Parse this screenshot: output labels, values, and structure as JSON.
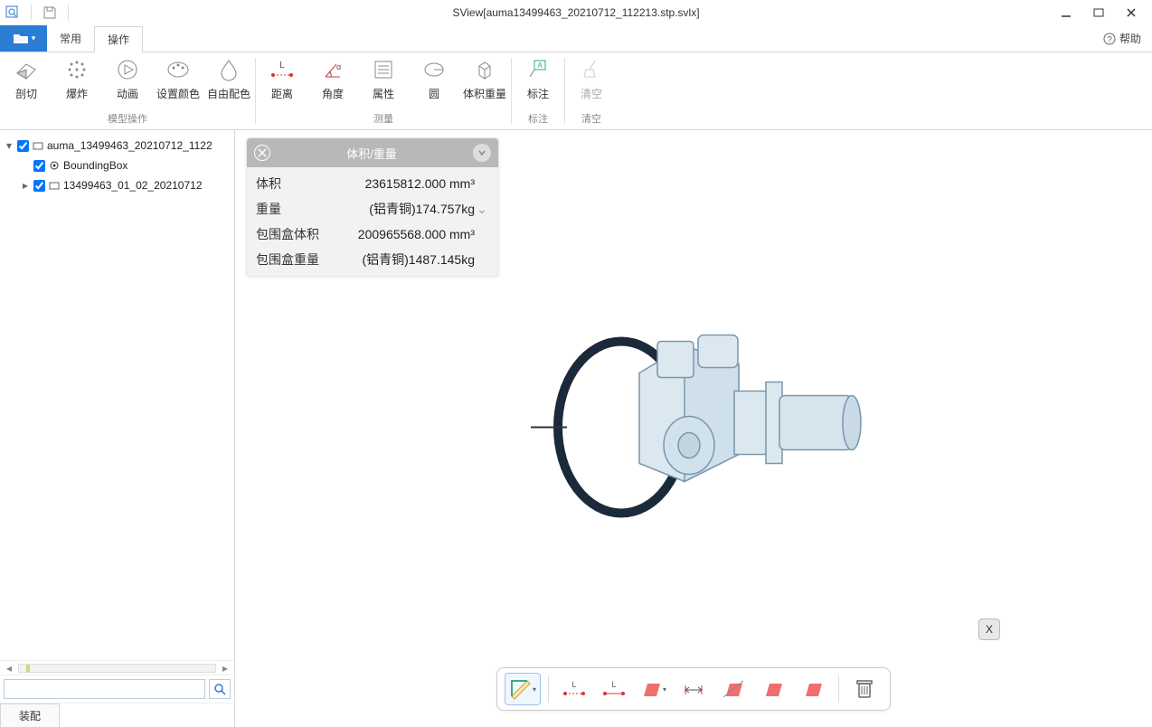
{
  "window": {
    "title": "SView[auma13499463_20210712_112213.stp.svlx]"
  },
  "menubar": {
    "file_icon": "file",
    "tabs": [
      {
        "label": "常用",
        "active": false
      },
      {
        "label": "操作",
        "active": true
      }
    ],
    "help_label": "帮助"
  },
  "ribbon": {
    "groups": [
      {
        "caption": "模型操作",
        "buttons": [
          {
            "id": "section",
            "label": "剖切"
          },
          {
            "id": "explode",
            "label": "爆炸"
          },
          {
            "id": "animate",
            "label": "动画"
          },
          {
            "id": "setcolor",
            "label": "设置颜色"
          },
          {
            "id": "freecolor",
            "label": "自由配色"
          }
        ]
      },
      {
        "caption": "测量",
        "buttons": [
          {
            "id": "distance",
            "label": "距离"
          },
          {
            "id": "angle",
            "label": "角度"
          },
          {
            "id": "attribute",
            "label": "属性"
          },
          {
            "id": "circle",
            "label": "圆"
          },
          {
            "id": "volweight",
            "label": "体积重量"
          }
        ]
      },
      {
        "caption": "标注",
        "buttons": [
          {
            "id": "annotate",
            "label": "标注"
          }
        ]
      },
      {
        "caption": "清空",
        "buttons": [
          {
            "id": "clear",
            "label": "清空",
            "disabled": true
          }
        ]
      }
    ]
  },
  "tree": {
    "nodes": [
      {
        "level": 0,
        "expander": "▾",
        "checked": true,
        "label": "auma_13499463_20210712_1122"
      },
      {
        "level": 1,
        "expander": "",
        "checked": true,
        "label": "BoundingBox",
        "icon": "gear"
      },
      {
        "level": 1,
        "expander": "▸",
        "checked": true,
        "label": "13499463_01_02_20210712"
      }
    ]
  },
  "sidebar_bottom": {
    "search_placeholder": "",
    "tab_label": "装配"
  },
  "prop_panel": {
    "title": "体积/重量",
    "rows": [
      {
        "key": "体积",
        "value": "23615812.000 mm³"
      },
      {
        "key": "重量",
        "value": "(铝青铜)174.757kg",
        "dropdown": true
      },
      {
        "key": "包围盒体积",
        "value": "200965568.000 mm³"
      },
      {
        "key": "包围盒重量",
        "value": "(铝青铜)1487.145kg"
      }
    ]
  },
  "float_close": "X",
  "bottom_toolbar": {
    "buttons": [
      {
        "id": "ruler",
        "selected": true
      },
      {
        "id": "dist1"
      },
      {
        "id": "dist2"
      },
      {
        "id": "section-plane"
      },
      {
        "id": "span"
      },
      {
        "id": "plane-a"
      },
      {
        "id": "plane-b"
      },
      {
        "id": "plane-c"
      },
      {
        "id": "trash"
      }
    ]
  }
}
